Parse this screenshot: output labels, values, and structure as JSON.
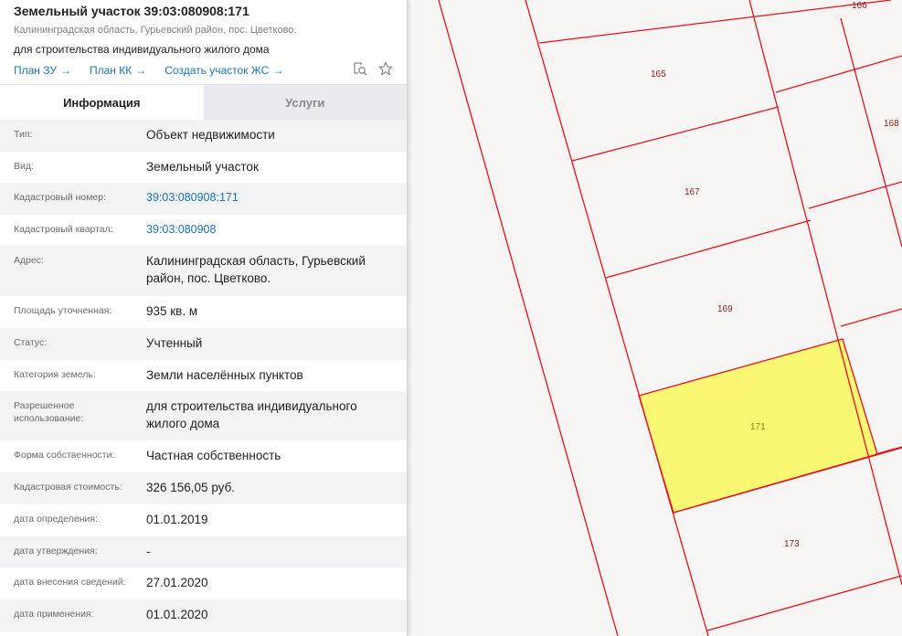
{
  "header": {
    "title": "Земельный участок 39:03:080908:171",
    "address": "Калининградская область, Гурьевский район, пос. Цветково.",
    "purpose": "для строительства индивидуального жилого дома",
    "links": [
      {
        "label": "План ЗУ",
        "arrow": "→"
      },
      {
        "label": "План КК",
        "arrow": "→"
      },
      {
        "label": "Создать участок ЖС",
        "arrow": "→"
      }
    ],
    "icons": {
      "search_plan": "search-map-icon",
      "favorite": "star-icon"
    }
  },
  "tabs": [
    {
      "label": "Информация",
      "active": true
    },
    {
      "label": "Услуги",
      "active": false
    }
  ],
  "info_rows": [
    {
      "label": "Тип:",
      "value": "Объект недвижимости"
    },
    {
      "label": "Вид:",
      "value": "Земельный участок"
    },
    {
      "label": "Кадастровый номер:",
      "value": "39:03:080908:171"
    },
    {
      "label": "Кадастровый квартал:",
      "value": "39:03:080908"
    },
    {
      "label": "Адрес:",
      "value": "Калининградская область, Гурьевский район, пос. Цветково."
    },
    {
      "label": "Площадь уточненная:",
      "value": "935 кв. м"
    },
    {
      "label": "Статус:",
      "value": "Учтенный"
    },
    {
      "label": "Категория земель:",
      "value": "Земли населённых пунктов"
    },
    {
      "label": "Разрешенное использование:",
      "value": "для строительства индивидуального жилого дома"
    },
    {
      "label": "Форма собственности:",
      "value": "Частная собственность"
    },
    {
      "label": "Кадастровая стоимость:",
      "value": "326 156,05 руб."
    },
    {
      "label": "дата определения:",
      "value": "01.01.2019"
    },
    {
      "label": "дата утверждения:",
      "value": "-"
    },
    {
      "label": "дата внесения сведений:",
      "value": "27.01.2020"
    },
    {
      "label": "дата применения:",
      "value": "01.01.2020"
    }
  ],
  "map": {
    "plots": [
      "166",
      "165",
      "168",
      "167",
      "169",
      "171",
      "173"
    ],
    "selected_plot": "171",
    "colors": {
      "boundary": "#e8101c",
      "selected_fill": "#faf772",
      "background": "#f6f5f4",
      "link": "#1a73b8"
    }
  }
}
